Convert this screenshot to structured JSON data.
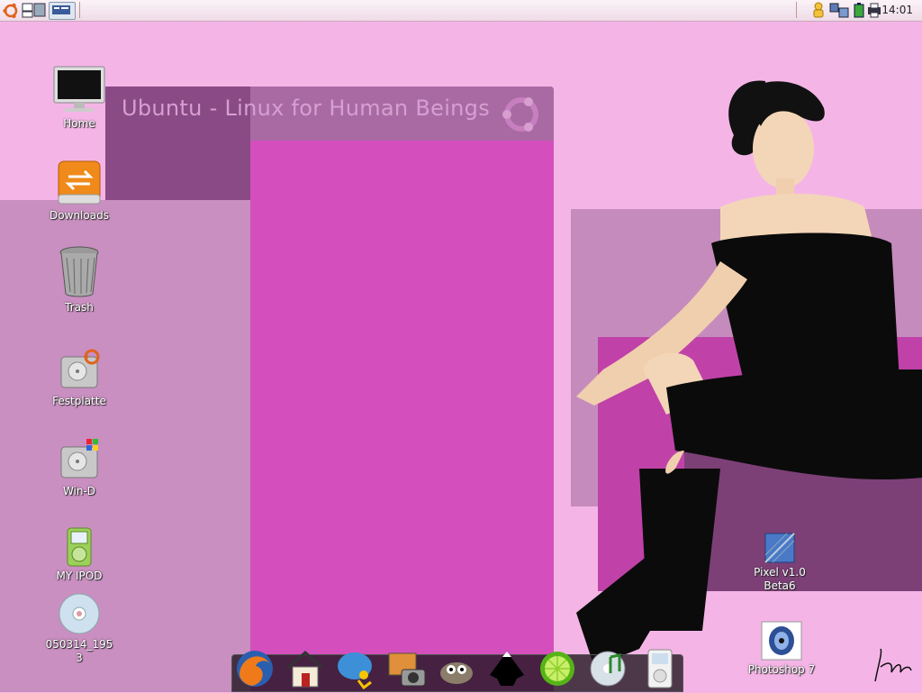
{
  "panel": {
    "clock": "14:01",
    "left_icons": [
      "ubuntu-menu-icon",
      "window-list-icon",
      "workspace-switcher-icon"
    ],
    "tray_icons": [
      "user-icon",
      "network-settings-icon",
      "battery-icon",
      "printer-icon"
    ]
  },
  "wallpaper": {
    "banner_title": "Ubuntu - Linux for Human Beings"
  },
  "desktop_icons": [
    {
      "label": "Home",
      "icon": "monitor-icon"
    },
    {
      "label": "Downloads",
      "icon": "drive-downloads-icon"
    },
    {
      "label": "Trash",
      "icon": "trash-icon"
    },
    {
      "label": "Festplatte",
      "icon": "harddisk-ubuntu-icon"
    },
    {
      "label": "Win-D",
      "icon": "harddisk-windows-icon"
    },
    {
      "label": "MY IPOD",
      "icon": "ipod-icon"
    },
    {
      "label": "050314_195\n3",
      "icon": "cdrom-icon"
    },
    {
      "label": "Pixel v1.0\nBeta6",
      "icon": "pixel-app-icon"
    },
    {
      "label": "Photoshop 7",
      "icon": "photoshop-icon"
    }
  ],
  "dock": {
    "items": [
      "firefox-icon",
      "home-folder-icon",
      "chat-icon",
      "photo-camera-icon",
      "gimp-icon",
      "inkscape-icon",
      "lime-icon",
      "music-cd-icon",
      "ipod-dock-icon"
    ]
  },
  "colors": {
    "background": "#f4b5e6",
    "magenta": "#d44fbd",
    "dark_purple": "#8a4a86"
  }
}
